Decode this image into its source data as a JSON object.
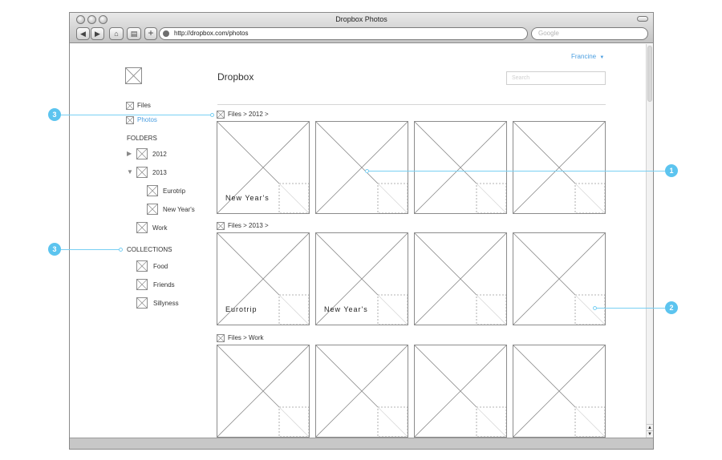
{
  "browser": {
    "title": "Dropbox Photos",
    "url": "http://dropbox.com/photos",
    "search_placeholder": "Google",
    "back_icon": "back-arrow-icon",
    "forward_icon": "forward-arrow-icon"
  },
  "header": {
    "user": "Francine",
    "page_title": "Dropbox",
    "search_placeholder": "Search"
  },
  "sidebar": {
    "files": "Files",
    "photos": "Photos",
    "folders_heading": "FOLDERS",
    "folders": [
      {
        "label": "2012",
        "expand": "▶"
      },
      {
        "label": "2013",
        "expand": "▼"
      },
      {
        "label": "Eurotrip"
      },
      {
        "label": "New Year's"
      },
      {
        "label": "Work"
      }
    ],
    "collections_heading": "COLLECTIONS",
    "collections": [
      "Food",
      "Friends",
      "Sillyness"
    ]
  },
  "groups": [
    {
      "path": "Files > 2012 >",
      "labels": [
        "New Year's",
        "",
        "",
        ""
      ]
    },
    {
      "path": "Files > 2013 >",
      "labels": [
        "Eurotrip",
        "New Year's",
        "",
        ""
      ]
    },
    {
      "path": "Files > Work",
      "labels": [
        "",
        "",
        "",
        ""
      ]
    }
  ],
  "callouts": [
    "3",
    "3",
    "1",
    "2"
  ],
  "colors": {
    "accent": "#5cc4ef",
    "link": "#4a9ee0"
  }
}
